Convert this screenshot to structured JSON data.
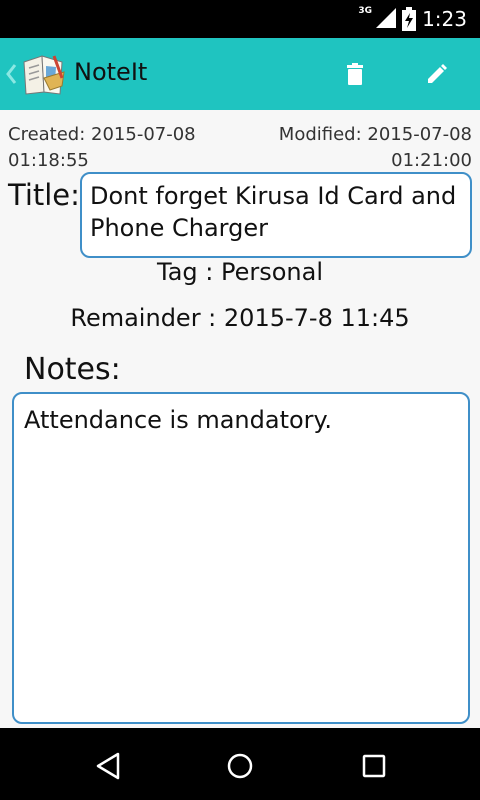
{
  "status_bar": {
    "network_type": "3G",
    "time": "1:23",
    "icons": [
      "signal-icon",
      "battery-icon"
    ]
  },
  "app_bar": {
    "title": "NoteIt",
    "background_color": "#1fc4c0",
    "icons": [
      "up-chevron-icon",
      "notebook-logo-icon",
      "delete-icon",
      "edit-icon"
    ]
  },
  "note": {
    "created": "Created: 2015-07-08",
    "created_time": "01:18:55",
    "modified": "Modified: 2015-07-08",
    "modified_time": "01:21:00",
    "title_label": "Title:",
    "title_value": "Dont forget Kirusa Id Card and Phone Charger",
    "tag_line": "Tag : Personal",
    "reminder_line": "Remainder : 2015-7-8 11:45",
    "notes_label": "Notes:",
    "notes_value": "Attendance is mandatory.",
    "field_border_color": "#3f8fc8"
  },
  "nav_bar": {
    "icons": [
      "back-icon",
      "home-icon",
      "recents-icon"
    ]
  }
}
